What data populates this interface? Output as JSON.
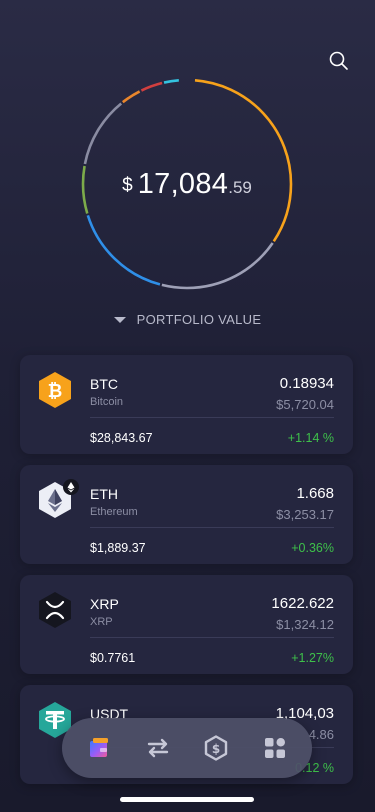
{
  "portfolio": {
    "currency_symbol": "$",
    "value_integer": "17,084",
    "value_decimal": ".59",
    "label": "PORTFOLIO VALUE"
  },
  "colors": {
    "positive": "#3ec04a",
    "btc": "#f7a21b",
    "eth": "#eceef6",
    "xrp": "#1d1e2a",
    "usdt": "#26a79a"
  },
  "coins": [
    {
      "symbol": "BTC",
      "name": "Bitcoin",
      "amount": "0.18934",
      "value": "$5,720.04",
      "price": "$28,843.67",
      "change": "+1.14 %",
      "icon": "bitcoin-icon"
    },
    {
      "symbol": "ETH",
      "name": "Ethereum",
      "amount": "1.668",
      "value": "$3,253.17",
      "price": "$1,889.37",
      "change": "+0.36%",
      "icon": "ethereum-icon"
    },
    {
      "symbol": "XRP",
      "name": "XRP",
      "amount": "1622.622",
      "value": "$1,324.12",
      "price": "$0.7761",
      "change": "+1.27%",
      "icon": "xrp-icon"
    },
    {
      "symbol": "USDT",
      "name": "",
      "amount": "1,104,03",
      "value": "4.86",
      "price": "",
      "change": "0.12 %",
      "icon": "tether-icon"
    }
  ],
  "tabbar": {
    "items": [
      "wallet-icon",
      "exchange-arrows-icon",
      "dollar-coin-icon",
      "apps-grid-icon"
    ]
  }
}
